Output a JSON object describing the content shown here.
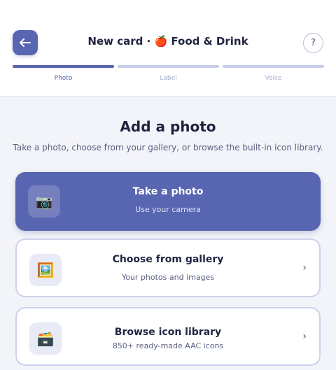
{
  "header": {
    "back_icon": "arrow-left-icon",
    "title": "New card · 🍎 Food & Drink",
    "help_label": "?",
    "steps": [
      {
        "label": "Photo",
        "active": true
      },
      {
        "label": "Label",
        "active": false
      },
      {
        "label": "Voice",
        "active": false
      }
    ]
  },
  "main": {
    "heading": "Add a photo",
    "subheading": "Take a photo, choose from your gallery, or browse the built-in icon library.",
    "options": [
      {
        "title": "Take a photo",
        "subtitle": "Use your camera",
        "icon": "📷",
        "icon_name": "camera-icon"
      },
      {
        "title": "Choose from gallery",
        "subtitle": "Your photos and images",
        "icon": "🖼️",
        "icon_name": "picture-icon"
      },
      {
        "title": "Browse icon library",
        "subtitle": "850+ ready-made AAC icons",
        "icon": "🗃️",
        "icon_name": "card-box-icon"
      }
    ],
    "chevron": "›"
  },
  "colors": {
    "accent": "#5865b0",
    "background": "#f3f4f9",
    "text": "#1f2440"
  }
}
